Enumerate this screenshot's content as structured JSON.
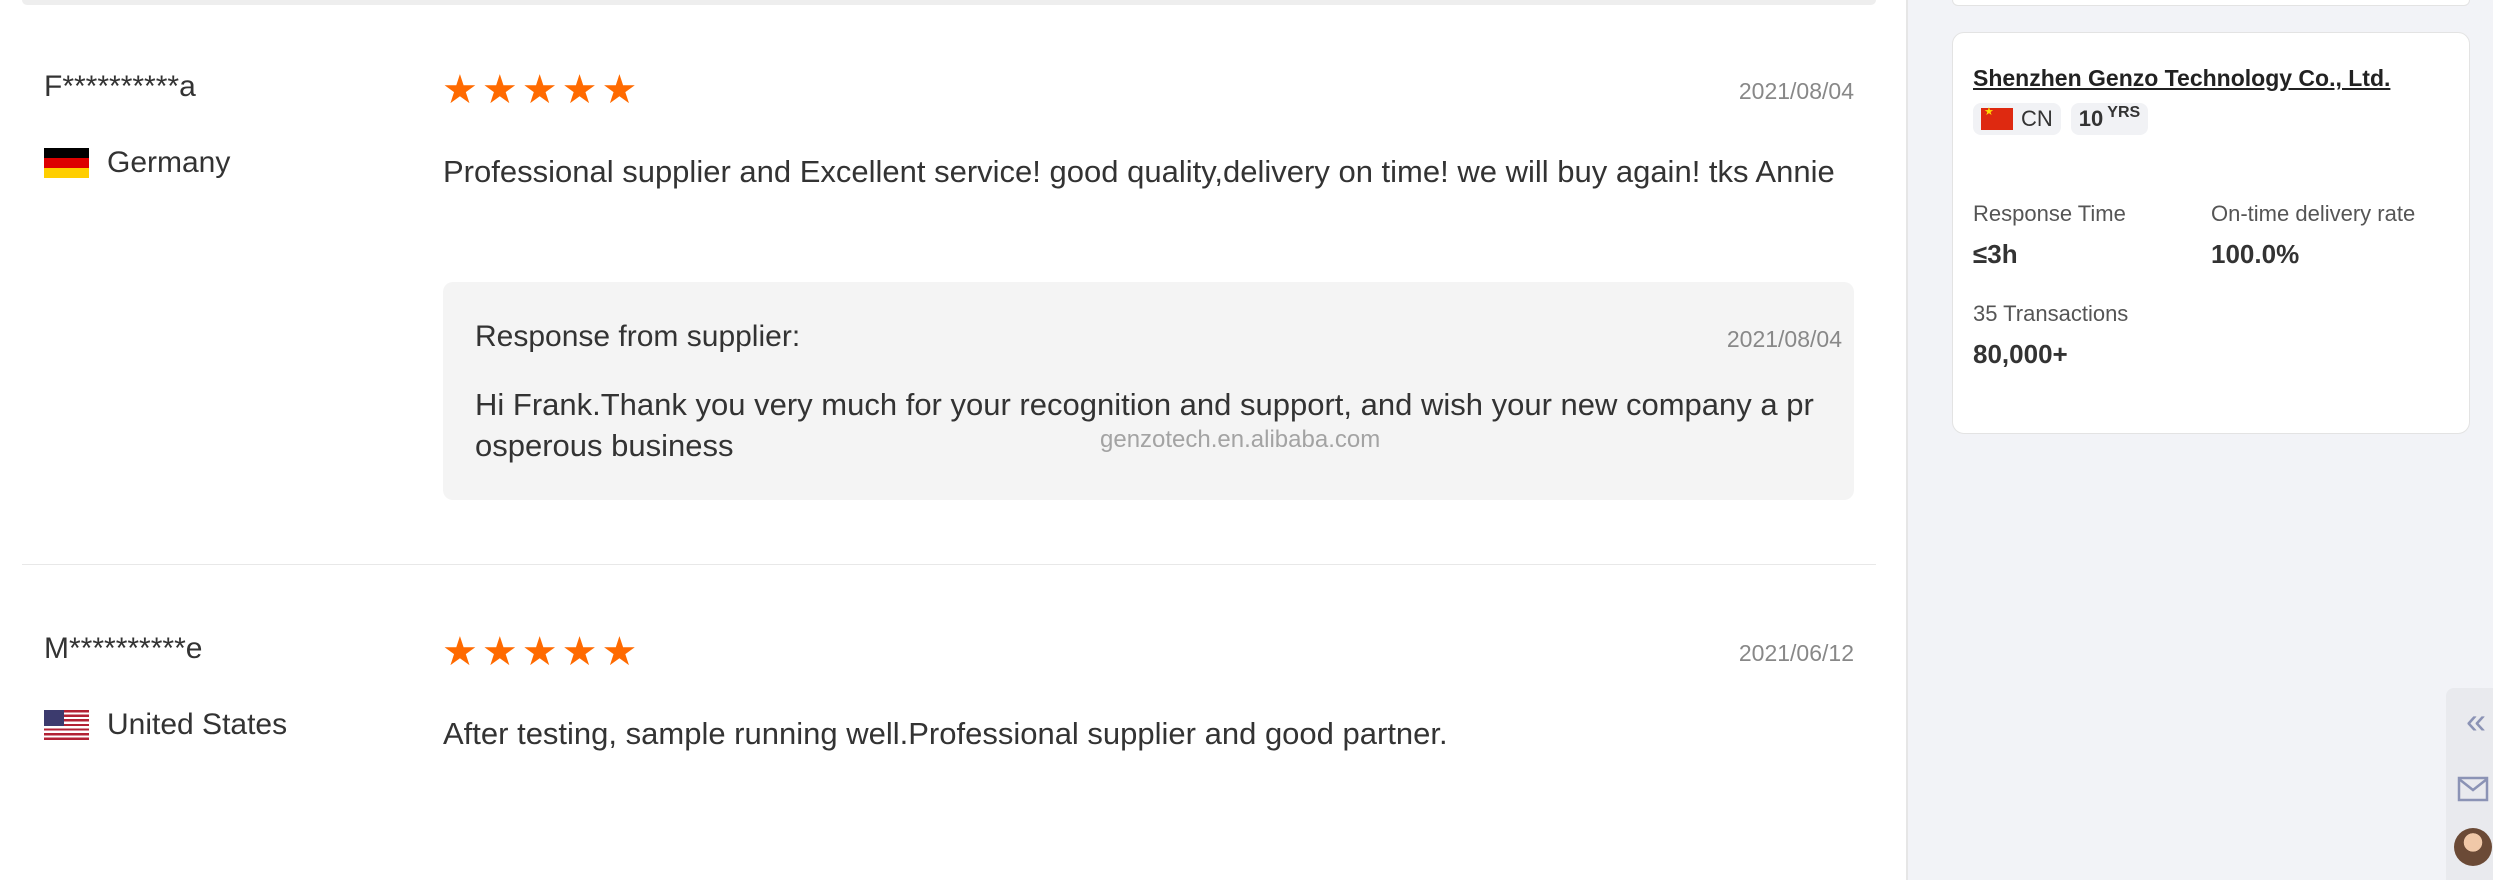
{
  "reviews": [
    {
      "reviewer": "F**********a",
      "country": "Germany",
      "flag_icon": "germany-flag-icon",
      "rating": 5,
      "stars": [
        "★",
        "★",
        "★",
        "★",
        "★"
      ],
      "date": "2021/08/04",
      "text": "Professional supplier and Excellent service! good quality,delivery on time! we will buy again! tks Annie",
      "response": {
        "label": "Response from supplier:",
        "date": "2021/08/04",
        "text": "Hi Frank.Thank you very much for your recognition and support, and wish your new company a prosperous business"
      }
    },
    {
      "reviewer": "M**********e",
      "country": "United States",
      "flag_icon": "usa-flag-icon",
      "rating": 5,
      "stars": [
        "★",
        "★",
        "★",
        "★",
        "★"
      ],
      "date": "2021/06/12",
      "text": "After testing, sample running well.Professional supplier and good partner."
    }
  ],
  "watermark": "genzotech.en.alibaba.com",
  "supplier": {
    "name": "Shenzhen Genzo Technology Co., Ltd.",
    "country_code": "CN",
    "years": "10",
    "years_unit": "YRS",
    "stats": {
      "response_time_label": "Response Time",
      "response_time_value": "≤3h",
      "ontime_label": "On-time delivery rate",
      "ontime_value": "100.0%",
      "transactions_label": "35 Transactions",
      "transactions_value": "80,000+"
    }
  },
  "float_bar": {
    "collapse_icon": "«",
    "mail_icon": "mail-icon",
    "avatar": "avatar"
  },
  "colors": {
    "star": "#ff6a00",
    "response_bg": "#f4f4f4",
    "sidebar_bg": "#f2f3f7",
    "float_icon": "#8b93b5"
  }
}
